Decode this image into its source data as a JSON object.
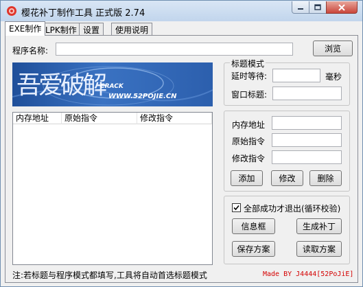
{
  "window": {
    "title": "樱花补丁制作工具 正式版 2.74"
  },
  "tabs": [
    {
      "label": "EXE制作"
    },
    {
      "label": "LPK制作"
    },
    {
      "label": "设置"
    },
    {
      "label": "使用说明"
    }
  ],
  "program": {
    "label": "程序名称:",
    "value": "",
    "browse_label": "浏览"
  },
  "banner": {
    "logo_text": "吾爱破解",
    "crack_text": "CRACK",
    "site_text": "WWW.52POJIE.CN"
  },
  "list": {
    "columns": [
      "内存地址",
      "原始指令",
      "修改指令"
    ],
    "rows": []
  },
  "title_mode": {
    "group_title": "标题模式",
    "delay_label": "延时等待:",
    "delay_value": "",
    "delay_unit": "毫秒",
    "window_title_label": "窗口标题:",
    "window_title_value": ""
  },
  "patch_edit": {
    "address_label": "内存地址",
    "original_label": "原始指令",
    "modified_label": "修改指令",
    "add_label": "添加",
    "modify_label": "修改",
    "delete_label": "删除"
  },
  "options": {
    "exit_check_label": "全部成功才退出(循环校验)",
    "exit_checked": true,
    "info_box_label": "信息框",
    "generate_label": "生成补丁",
    "save_label": "保存方案",
    "load_label": "读取方案"
  },
  "footer": {
    "note": "注:若标题与程序模式都填写,工具将自动首选标题模式",
    "made_by": "Made BY J4444[52PoJiE]"
  }
}
